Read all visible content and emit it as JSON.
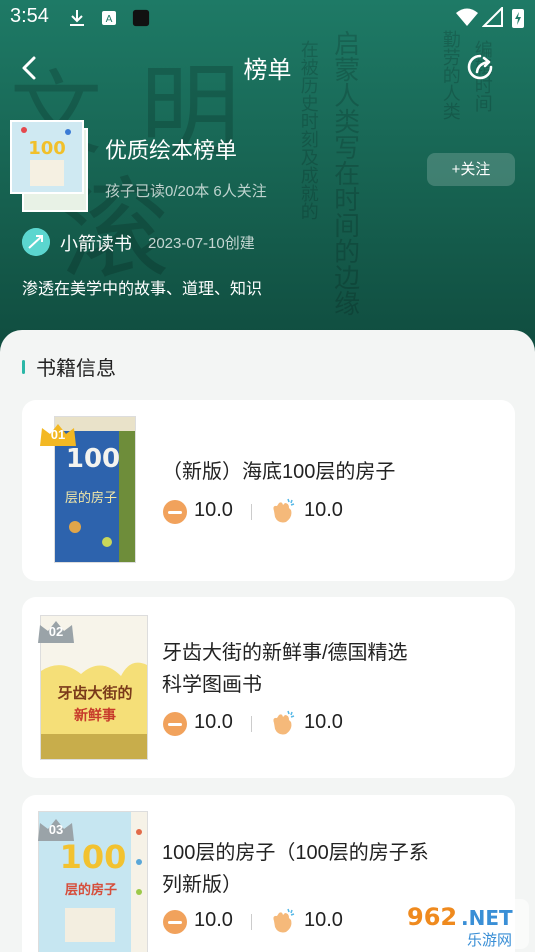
{
  "status_bar": {
    "time": "3:54"
  },
  "nav": {
    "title": "榜单"
  },
  "hero": {
    "list_title": "优质绘本榜单",
    "meta": "孩子已读0/20本 6人关注",
    "follow_label": "+关注",
    "author": "小箭读书",
    "created": "2023-07-10创建",
    "description": "渗透在美学中的故事、道理、知识"
  },
  "section": {
    "title": "书籍信息"
  },
  "books": [
    {
      "rank": "01",
      "title_lines": [
        "（新版）海底100层的房子"
      ],
      "score_a": "10.0",
      "score_b": "10.0"
    },
    {
      "rank": "02",
      "title_lines": [
        "牙齿大街的新鲜事/德国精选",
        "科学图画书"
      ],
      "score_a": "10.0",
      "score_b": "10.0"
    },
    {
      "rank": "03",
      "title_lines": [
        "100层的房子（100层的房子系",
        "列新版）"
      ],
      "score_a": "10.0",
      "score_b": "10.0"
    }
  ],
  "watermark": {
    "number": "962",
    "suffix": ".NET",
    "name": "乐游网"
  },
  "colors": {
    "hero_top": "#1e7a66",
    "hero_bottom": "#0f4a3d",
    "accent": "#2bb7a7",
    "rank_gold": "#f3b823",
    "rank_gray": "#9aa3a8",
    "face": "#f1a25c",
    "hand": "#f5b97a"
  }
}
